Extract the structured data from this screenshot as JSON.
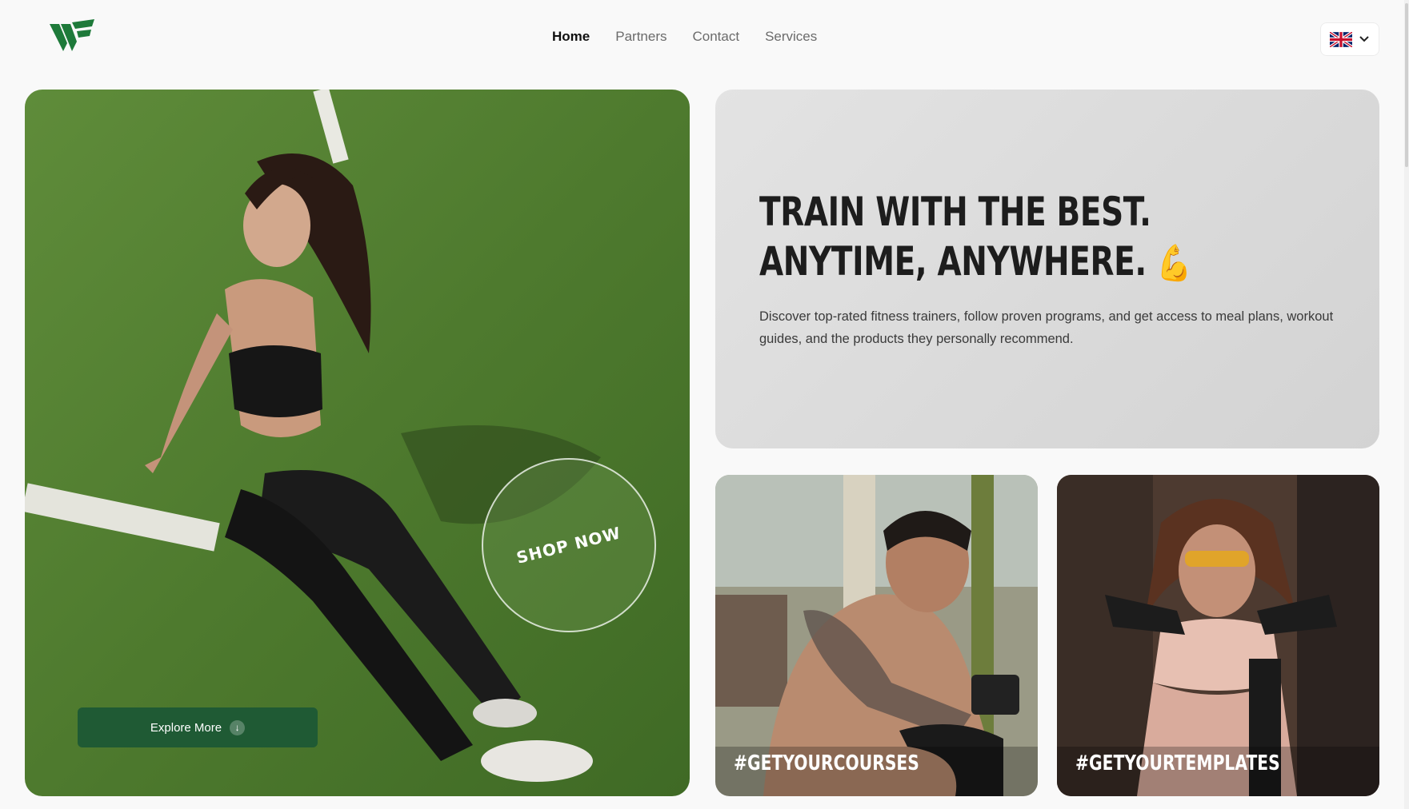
{
  "nav": {
    "items": [
      {
        "label": "Home",
        "active": true
      },
      {
        "label": "Partners",
        "active": false
      },
      {
        "label": "Contact",
        "active": false
      },
      {
        "label": "Services",
        "active": false
      }
    ]
  },
  "language": {
    "icon": "uk-flag-icon",
    "chevron": "chevron-down-icon"
  },
  "hero": {
    "shop_now": "SHOP NOW",
    "explore_label": "Explore More"
  },
  "intro": {
    "headline_line1": "TRAIN WITH THE BEST.",
    "headline_line2": "ANYTIME, ANYWHERE.",
    "emoji": "💪",
    "description": "Discover top-rated fitness trainers, follow proven programs, and get access to meal plans, workout guides, and the products they personally recommend."
  },
  "tiles": [
    {
      "label": "#GETYOURCOURSES"
    },
    {
      "label": "#GETYOURTEMPLATES"
    }
  ],
  "colors": {
    "brand_green": "#1f5a34",
    "logo_green": "#1e7a3a"
  }
}
